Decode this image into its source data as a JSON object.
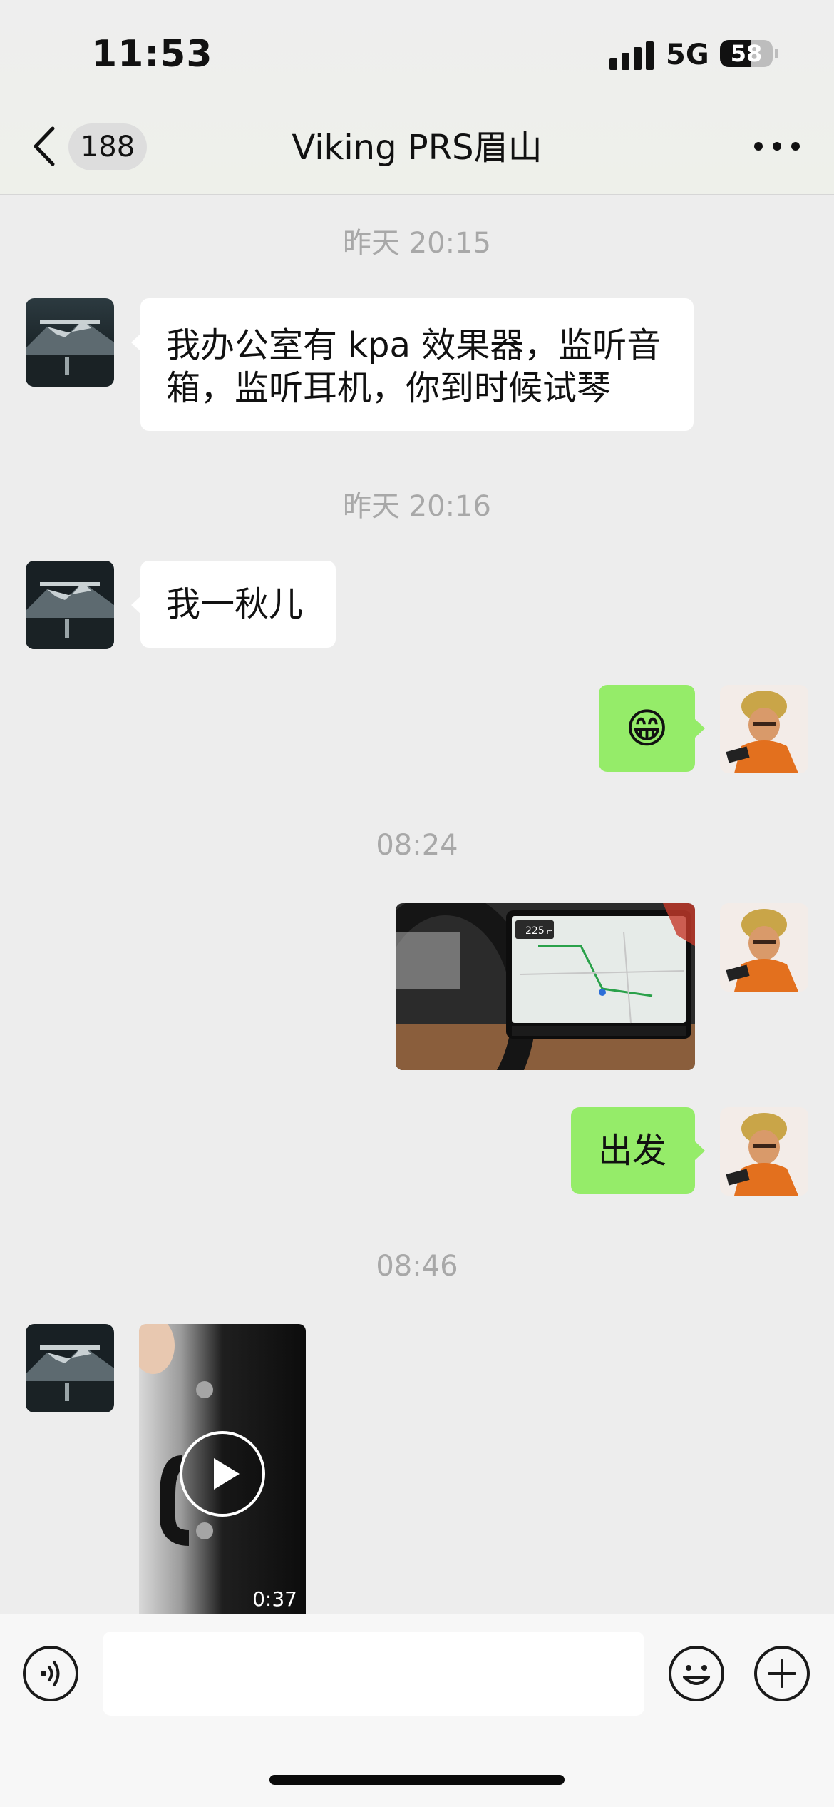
{
  "status_bar": {
    "time": "11:53",
    "network": "5G",
    "battery": "58"
  },
  "header": {
    "unread_count": "188",
    "title": "Viking PRS眉山"
  },
  "messages": [
    {
      "type": "timestamp",
      "text": "昨天 20:15"
    },
    {
      "type": "text",
      "direction": "in",
      "text_line1": "我办公室有 kpa 效果器，监听音",
      "text_line2": "箱，监听耳机，你到时候试琴"
    },
    {
      "type": "timestamp",
      "text": "昨天 20:16"
    },
    {
      "type": "text",
      "direction": "in",
      "text": "我一秋儿"
    },
    {
      "type": "emoji",
      "direction": "out",
      "emoji": "😁"
    },
    {
      "type": "timestamp",
      "text": "08:24"
    },
    {
      "type": "image",
      "direction": "out",
      "nav_distance": "225",
      "nav_unit": "m"
    },
    {
      "type": "text",
      "direction": "out",
      "text": "出发"
    },
    {
      "type": "timestamp",
      "text": "08:46"
    },
    {
      "type": "video",
      "direction": "in",
      "duration": "0:37"
    }
  ],
  "input": {
    "placeholder": ""
  },
  "colors": {
    "outgoing_bubble": "#95ec69",
    "incoming_bubble": "#ffffff",
    "background": "#ededed"
  }
}
